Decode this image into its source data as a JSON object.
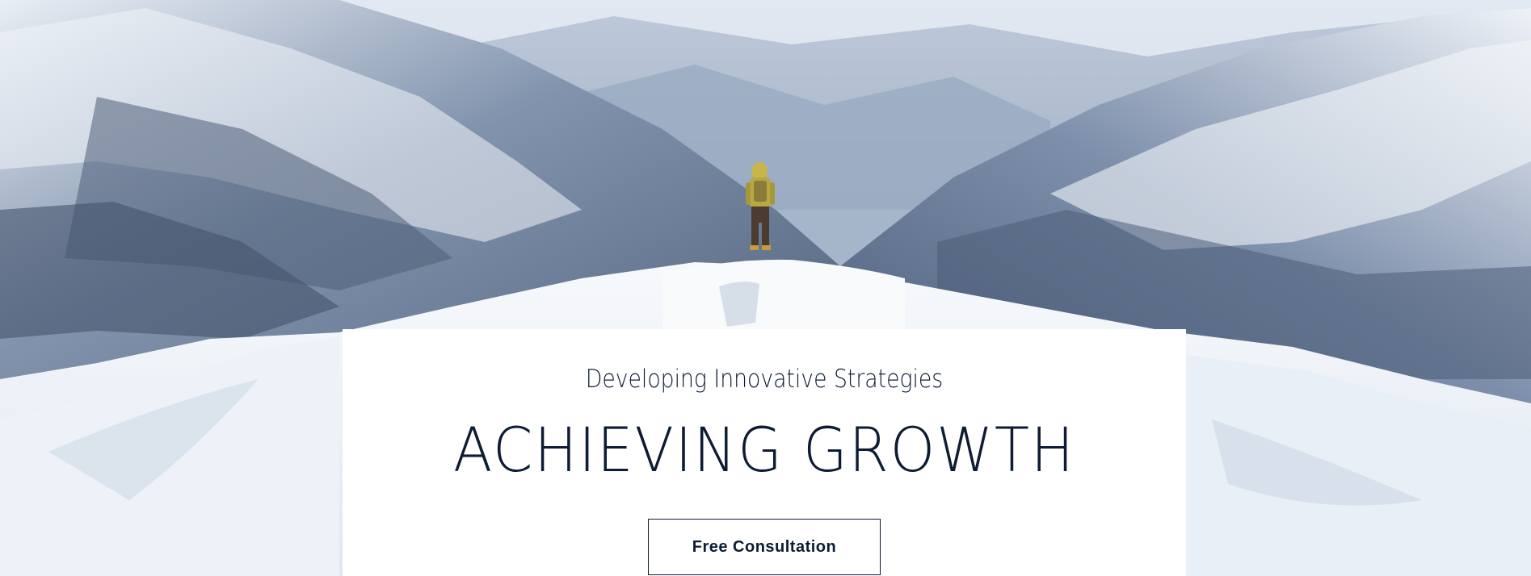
{
  "hero": {
    "subtitle": "Developing Innovative Strategies",
    "headline": "ACHIEVING GROWTH",
    "cta_label": "Free Consultation"
  },
  "colors": {
    "text_navy": "#0d1c33",
    "card_bg": "#ffffff",
    "snow": "#f2f5fa",
    "mountain_shadow": "#5b6d88"
  },
  "background_image": {
    "subject": "hiker-on-snowy-mountain-summit"
  }
}
